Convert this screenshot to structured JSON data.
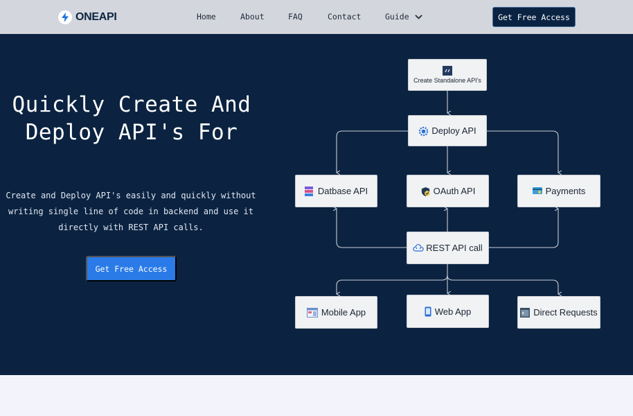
{
  "nav": {
    "logo_text": "ONEAPI",
    "items": [
      "Home",
      "About",
      "FAQ",
      "Contact",
      "Guide"
    ],
    "cta": "Get Free Access"
  },
  "hero": {
    "title_line1": "Quickly Create And",
    "title_line2": "Deploy API's For",
    "desc_line1": "Create and Deploy API's easily and quickly without",
    "desc_line2": "writing single line of code in backend and use it",
    "desc_line3": "directly with REST API calls.",
    "cta": "Get Free Access"
  },
  "diagram": {
    "create": "Create Standalone API's",
    "deploy": "Deploy API",
    "database": "Datbase API",
    "oauth": "OAuth API",
    "payments": "Payments",
    "rest": "REST API call",
    "mobile": "Mobile App",
    "web": "Web App",
    "direct": "Direct Requests"
  },
  "colors": {
    "navbar": "#d4d6dd",
    "hero_bg": "#0b2341",
    "accent": "#2a7be8",
    "node_bg": "#f1f2f4"
  }
}
